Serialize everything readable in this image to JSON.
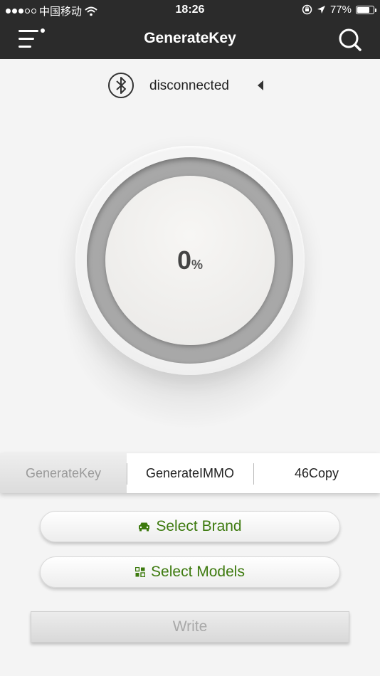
{
  "status_bar": {
    "carrier": "中国移动",
    "time": "18:26",
    "battery": "77%",
    "battery_level": 0.77,
    "signal_bars": 3
  },
  "nav": {
    "title": "GenerateKey",
    "menu_icon": "hamburger-menu-icon",
    "search_icon": "search-icon"
  },
  "connection": {
    "status": "disconnected",
    "icon": "bluetooth-icon"
  },
  "gauge": {
    "value": "0",
    "unit": "%",
    "progress": 0
  },
  "tabs": [
    {
      "label": "GenerateKey",
      "active": true
    },
    {
      "label": "GenerateIMMO",
      "active": false
    },
    {
      "label": "46Copy",
      "active": false
    }
  ],
  "actions": {
    "select_brand": "Select Brand",
    "select_models": "Select Models",
    "write": "Write"
  },
  "colors": {
    "navbar_bg": "#2b2b2b",
    "accent_green": "#3d7a0e",
    "disabled_text": "#a8a8a8"
  }
}
